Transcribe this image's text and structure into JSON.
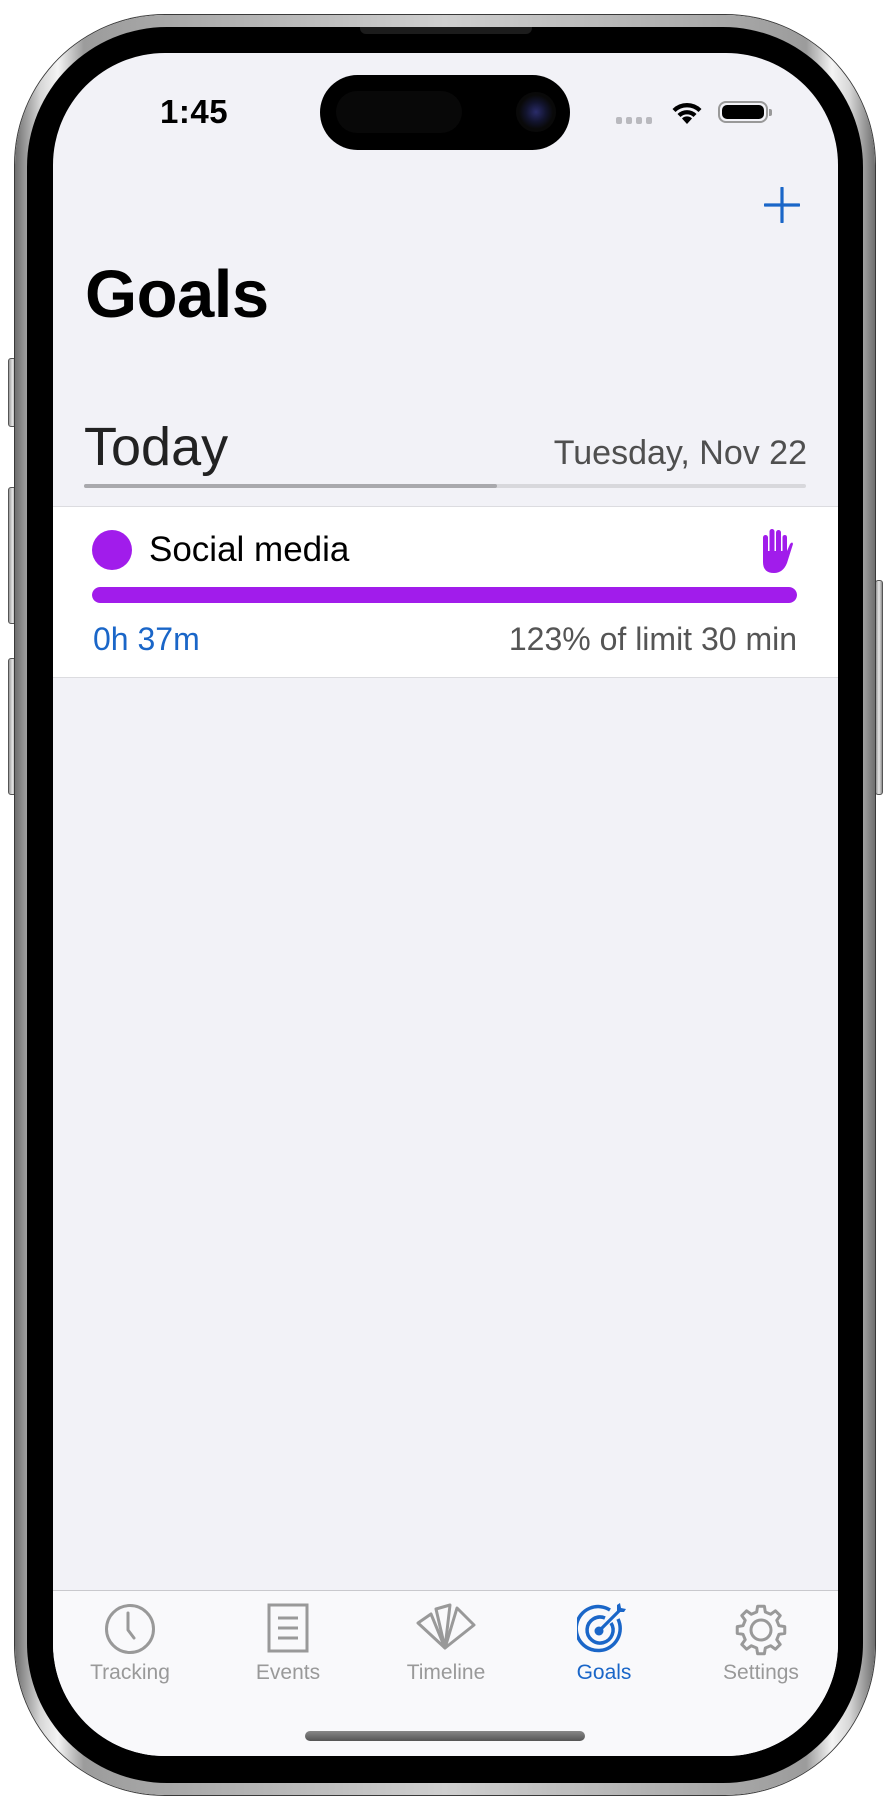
{
  "status_bar": {
    "time": "1:45",
    "signal_icon": "cellular-signal-icon",
    "wifi_icon": "wifi-icon",
    "battery_icon": "battery-icon"
  },
  "nav": {
    "add_icon": "plus-icon",
    "title": "Goals"
  },
  "section": {
    "title": "Today",
    "date": "Tuesday, Nov 22",
    "day_progress_fraction": 0.572
  },
  "goals": [
    {
      "name": "Social media",
      "color": "#a11ceb",
      "icon": "hand-raised-icon",
      "time_spent": "0h 37m",
      "limit_text": "123% of limit 30 min",
      "progress_fraction": 1.0
    }
  ],
  "tabs": [
    {
      "label": "Tracking",
      "icon": "clock-icon",
      "active": false
    },
    {
      "label": "Events",
      "icon": "list-document-icon",
      "active": false
    },
    {
      "label": "Timeline",
      "icon": "fan-cards-icon",
      "active": false
    },
    {
      "label": "Goals",
      "icon": "target-arrow-icon",
      "active": true
    },
    {
      "label": "Settings",
      "icon": "gear-icon",
      "active": false
    }
  ],
  "colors": {
    "accent": "#1a66c8",
    "inactive_tab": "#999999",
    "background": "#f2f2f7"
  }
}
